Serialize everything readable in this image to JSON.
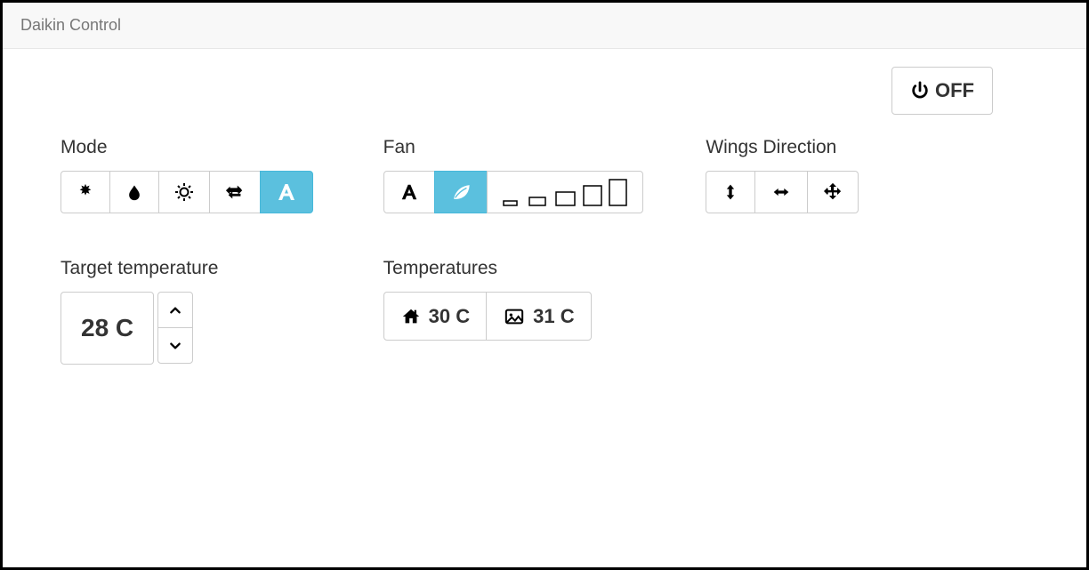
{
  "navbar": {
    "brand": "Daikin Control"
  },
  "power": {
    "label": "OFF"
  },
  "sections": {
    "mode": {
      "title": "Mode"
    },
    "fan": {
      "title": "Fan"
    },
    "wings": {
      "title": "Wings Direction"
    },
    "target_temp": {
      "title": "Target temperature",
      "value": "28 C"
    },
    "temperatures": {
      "title": "Temperatures",
      "indoor": "30 C",
      "outdoor": "31 C"
    }
  }
}
